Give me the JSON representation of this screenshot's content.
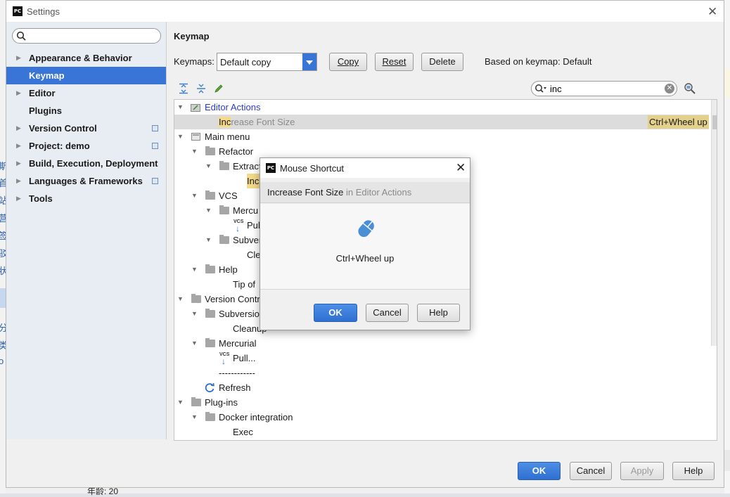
{
  "window": {
    "title": "Settings"
  },
  "sidebar": {
    "search_placeholder": "",
    "items": [
      {
        "label": "Appearance & Behavior",
        "expandable": true,
        "has_copy_icon": false
      },
      {
        "label": "Keymap",
        "expandable": false,
        "has_copy_icon": false,
        "selected": true
      },
      {
        "label": "Editor",
        "expandable": true,
        "has_copy_icon": false
      },
      {
        "label": "Plugins",
        "expandable": false,
        "has_copy_icon": false
      },
      {
        "label": "Version Control",
        "expandable": true,
        "has_copy_icon": true
      },
      {
        "label": "Project: demo",
        "expandable": true,
        "has_copy_icon": true
      },
      {
        "label": "Build, Execution, Deployment",
        "expandable": true,
        "has_copy_icon": false
      },
      {
        "label": "Languages & Frameworks",
        "expandable": true,
        "has_copy_icon": true
      },
      {
        "label": "Tools",
        "expandable": true,
        "has_copy_icon": false
      }
    ]
  },
  "keymap": {
    "section_title": "Keymap",
    "keymaps_label": "Keymaps:",
    "selected_keymap": "Default copy",
    "copy_button": "Copy",
    "reset_button": "Reset",
    "delete_button": "Delete",
    "based_on": "Based on keymap: Default",
    "filter_value": "inc",
    "toolbar_icons": [
      "expand-all-icon",
      "collapse-all-icon",
      "edit-icon"
    ]
  },
  "tree": {
    "rows": [
      {
        "label": "Editor Actions",
        "style": "blue",
        "toggle": "open"
      },
      {
        "match": "Inc",
        "rest": "rease Font Size",
        "style": "grey",
        "shortcut": "Ctrl+Wheel up",
        "highlighted": true
      },
      {
        "label": "Main menu",
        "toggle": "open"
      },
      {
        "label": "Refactor",
        "toggle": "open"
      },
      {
        "label": "Extract",
        "toggle": "open"
      },
      {
        "match": "Incl"
      },
      {
        "label": "VCS",
        "toggle": "open"
      },
      {
        "label": "Mercu",
        "toggle": "open"
      },
      {
        "label": "Pull"
      },
      {
        "label": "Subver",
        "toggle": "open"
      },
      {
        "label": "Cle"
      },
      {
        "label": "Help",
        "toggle": "open"
      },
      {
        "label": "Tip of"
      },
      {
        "label": "Version Contr",
        "toggle": "open"
      },
      {
        "label": "Subversion",
        "toggle": "open"
      },
      {
        "label": "Cleanup"
      },
      {
        "label": "Mercurial",
        "toggle": "open"
      },
      {
        "label": "Pull..."
      },
      {
        "label": "------------"
      },
      {
        "label": "Refresh"
      },
      {
        "label": "Plug-ins",
        "toggle": "open"
      },
      {
        "label": "Docker integration",
        "toggle": "open"
      },
      {
        "label": "Exec"
      }
    ]
  },
  "footer": {
    "ok": "OK",
    "cancel": "Cancel",
    "apply": "Apply",
    "help": "Help"
  },
  "dialog": {
    "title": "Mouse Shortcut",
    "action": "Increase Font Size",
    "context": "in Editor Actions",
    "shortcut": "Ctrl+Wheel up",
    "ok": "OK",
    "cancel": "Cancel",
    "help": "Help"
  },
  "background": {
    "left_chars": [
      "斯",
      "首",
      "站",
      "营",
      "签",
      "驳",
      "状",
      "分",
      "类",
      "o"
    ],
    "bottom_text": "年龄: 20"
  },
  "colors": {
    "accent": "#3875d6",
    "match_highlight": "#f5da8a",
    "shortcut_highlight": "#e3d08a",
    "link_blue": "#2a3cc8"
  }
}
